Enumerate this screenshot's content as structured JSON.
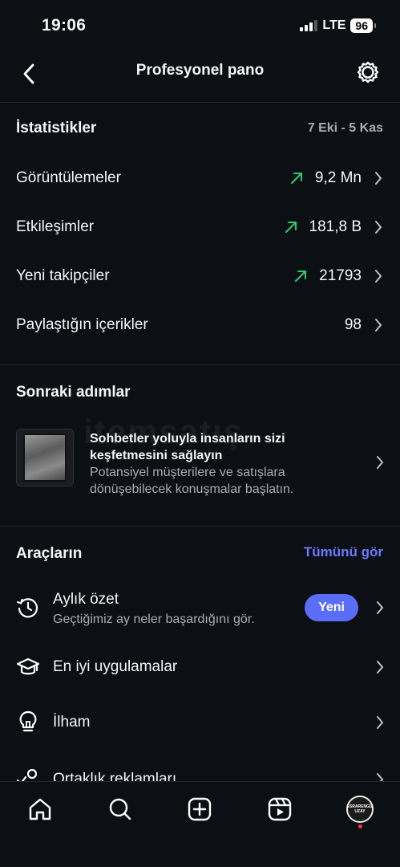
{
  "status_bar": {
    "time": "19:06",
    "network": "LTE",
    "battery": "96"
  },
  "header": {
    "title": "Profesyonel pano"
  },
  "stats": {
    "heading": "İstatistikler",
    "date_range": "7 Eki - 5 Kas",
    "rows": [
      {
        "label": "Görüntülemeler",
        "value": "9,2 Mn",
        "trend": "up"
      },
      {
        "label": "Etkileşimler",
        "value": "181,8 B",
        "trend": "up"
      },
      {
        "label": "Yeni takipçiler",
        "value": "21793",
        "trend": "up"
      },
      {
        "label": "Paylaştığın içerikler",
        "value": "98",
        "trend": "none"
      }
    ]
  },
  "next_steps": {
    "heading": "Sonraki adımlar",
    "card": {
      "title": "Sohbetler yoluyla insanların sizi keşfetmesini sağlayın",
      "description": "Potansiyel müşterilere ve satışlara dönüşebilecek konuşmalar başlatın."
    },
    "watermark": "itemsatış"
  },
  "tools": {
    "heading": "Araçların",
    "see_all": "Tümünü gör",
    "items": [
      {
        "label": "Aylık özet",
        "subtitle": "Geçtiğimiz ay neler başardığını gör.",
        "badge": "Yeni",
        "icon": "history-icon"
      },
      {
        "label": "En iyi uygulamalar",
        "icon": "graduation-cap-icon"
      },
      {
        "label": "İlham",
        "icon": "lightbulb-icon"
      },
      {
        "label": "Ortaklık reklamları",
        "icon": "partnership-icon"
      }
    ]
  },
  "tabbar": {
    "items": [
      "home-icon",
      "search-icon",
      "create-icon",
      "reels-icon",
      "profile-avatar"
    ],
    "avatar_text": "ESRARENGİZ UZAY"
  },
  "colors": {
    "accent": "#5a6df6",
    "link": "#6b7bff",
    "trend_up": "#2ecc71",
    "background": "#0c0f14"
  }
}
